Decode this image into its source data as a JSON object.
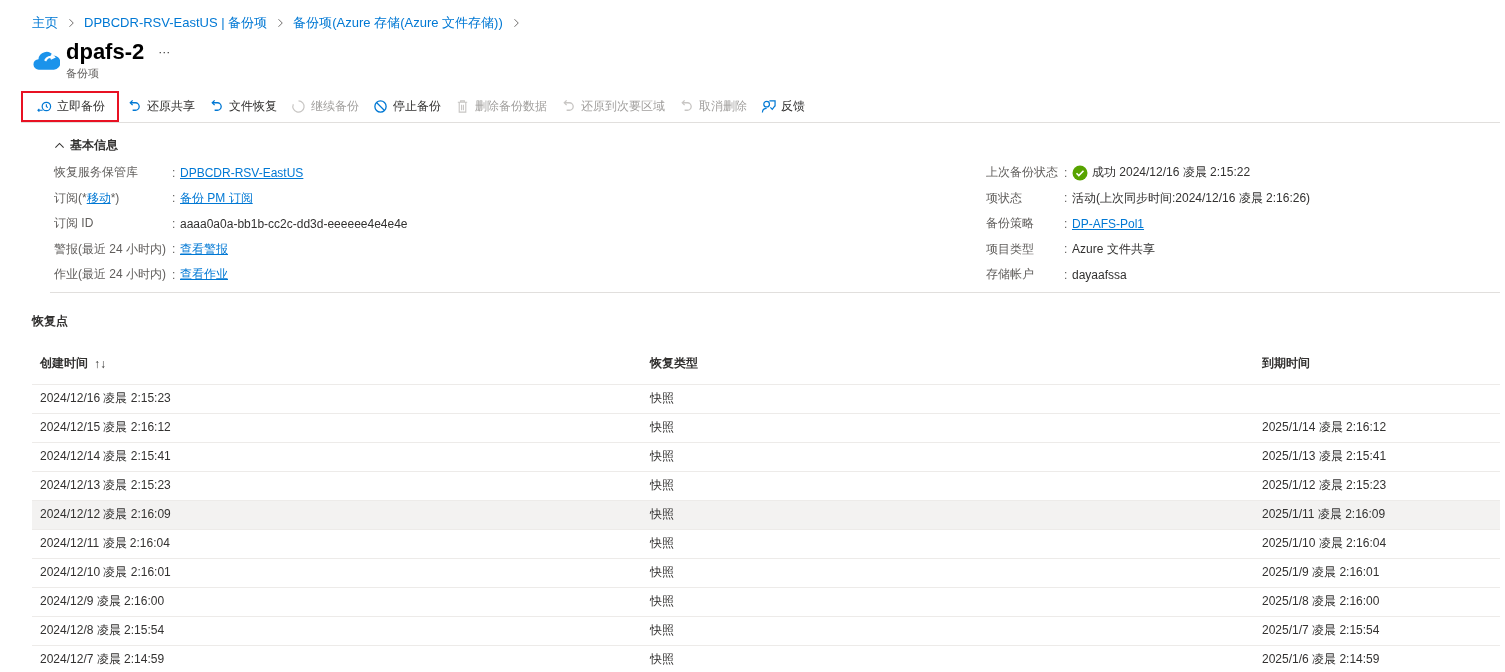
{
  "breadcrumb": [
    "主页",
    "DPBCDR-RSV-EastUS | 备份项",
    "备份项(Azure 存储(Azure 文件存储))"
  ],
  "header": {
    "title": "dpafs-2",
    "more": "···",
    "subtitle": "备份项"
  },
  "toolbar": [
    {
      "kind": "backup",
      "label": "立即备份",
      "disabled": false,
      "highlighted": true
    },
    {
      "kind": "undo",
      "label": "还原共享",
      "disabled": false,
      "highlighted": false
    },
    {
      "kind": "undo",
      "label": "文件恢复",
      "disabled": false,
      "highlighted": false
    },
    {
      "kind": "resume",
      "label": "继续备份",
      "disabled": true,
      "highlighted": false
    },
    {
      "kind": "stop",
      "label": "停止备份",
      "disabled": false,
      "highlighted": false
    },
    {
      "kind": "delete",
      "label": "删除备份数据",
      "disabled": true,
      "highlighted": false
    },
    {
      "kind": "undo",
      "label": "还原到次要区域",
      "disabled": true,
      "highlighted": false
    },
    {
      "kind": "undo",
      "label": "取消删除",
      "disabled": true,
      "highlighted": false
    },
    {
      "kind": "feedback",
      "label": "反馈",
      "disabled": false,
      "highlighted": false
    }
  ],
  "essentials": {
    "title": "基本信息",
    "expanded": true,
    "left": [
      {
        "label": "恢复服务保管库",
        "separator": ":",
        "kind": "link",
        "value": "DPBCDR-RSV-EastUS"
      },
      {
        "label_prefix": "订阅(*",
        "label_link": "移动",
        "label_suffix": "*)",
        "separator": ":",
        "kind": "link",
        "value": "备份 PM 订阅"
      },
      {
        "label": "订阅 ID",
        "separator": ":",
        "kind": "text",
        "value": "aaaa0a0a-bb1b-cc2c-dd3d-eeeeee4e4e4e"
      },
      {
        "label": "警报(最近 24 小时内)",
        "separator": ":",
        "kind": "link",
        "value": "查看警报"
      },
      {
        "label": "作业(最近 24 小时内)",
        "separator": ":",
        "kind": "link",
        "value": "查看作业"
      }
    ],
    "right": [
      {
        "label": "上次备份状态",
        "separator": ":",
        "kind": "status",
        "value": "成功 2024/12/16 凌晨 2:15:22"
      },
      {
        "label": "项状态",
        "separator": ":",
        "kind": "text",
        "value": "活动(上次同步时间:2024/12/16 凌晨 2:16:26)"
      },
      {
        "label": "备份策略",
        "separator": ":",
        "kind": "link",
        "value": "DP-AFS-Pol1"
      },
      {
        "label": "项目类型",
        "separator": ":",
        "kind": "text",
        "value": "Azure 文件共享"
      },
      {
        "label": "存储帐户",
        "separator": ":",
        "kind": "text",
        "value": "dayaafssa"
      }
    ]
  },
  "recovery_points": {
    "title": "恢复点",
    "columns": [
      {
        "label": "创建时间",
        "sort": "↑↓"
      },
      {
        "label": "恢复类型"
      },
      {
        "label": "到期时间"
      }
    ],
    "rows": [
      {
        "cells": [
          "2024/12/16 凌晨 2:15:23",
          "快照",
          ""
        ],
        "selected": false
      },
      {
        "cells": [
          "2024/12/15 凌晨 2:16:12",
          "快照",
          "2025/1/14 凌晨 2:16:12"
        ],
        "selected": false
      },
      {
        "cells": [
          "2024/12/14 凌晨 2:15:41",
          "快照",
          "2025/1/13 凌晨 2:15:41"
        ],
        "selected": false
      },
      {
        "cells": [
          "2024/12/13 凌晨 2:15:23",
          "快照",
          "2025/1/12 凌晨 2:15:23"
        ],
        "selected": false
      },
      {
        "cells": [
          "2024/12/12 凌晨 2:16:09",
          "快照",
          "2025/1/11 凌晨 2:16:09"
        ],
        "selected": true
      },
      {
        "cells": [
          "2024/12/11 凌晨 2:16:04",
          "快照",
          "2025/1/10 凌晨 2:16:04"
        ],
        "selected": false
      },
      {
        "cells": [
          "2024/12/10 凌晨 2:16:01",
          "快照",
          "2025/1/9 凌晨 2:16:01"
        ],
        "selected": false
      },
      {
        "cells": [
          "2024/12/9 凌晨 2:16:00",
          "快照",
          "2025/1/8 凌晨 2:16:00"
        ],
        "selected": false
      },
      {
        "cells": [
          "2024/12/8 凌晨 2:15:54",
          "快照",
          "2025/1/7 凌晨 2:15:54"
        ],
        "selected": false
      },
      {
        "cells": [
          "2024/12/7 凌晨 2:14:59",
          "快照",
          "2025/1/6 凌晨 2:14:59"
        ],
        "selected": false
      }
    ]
  }
}
